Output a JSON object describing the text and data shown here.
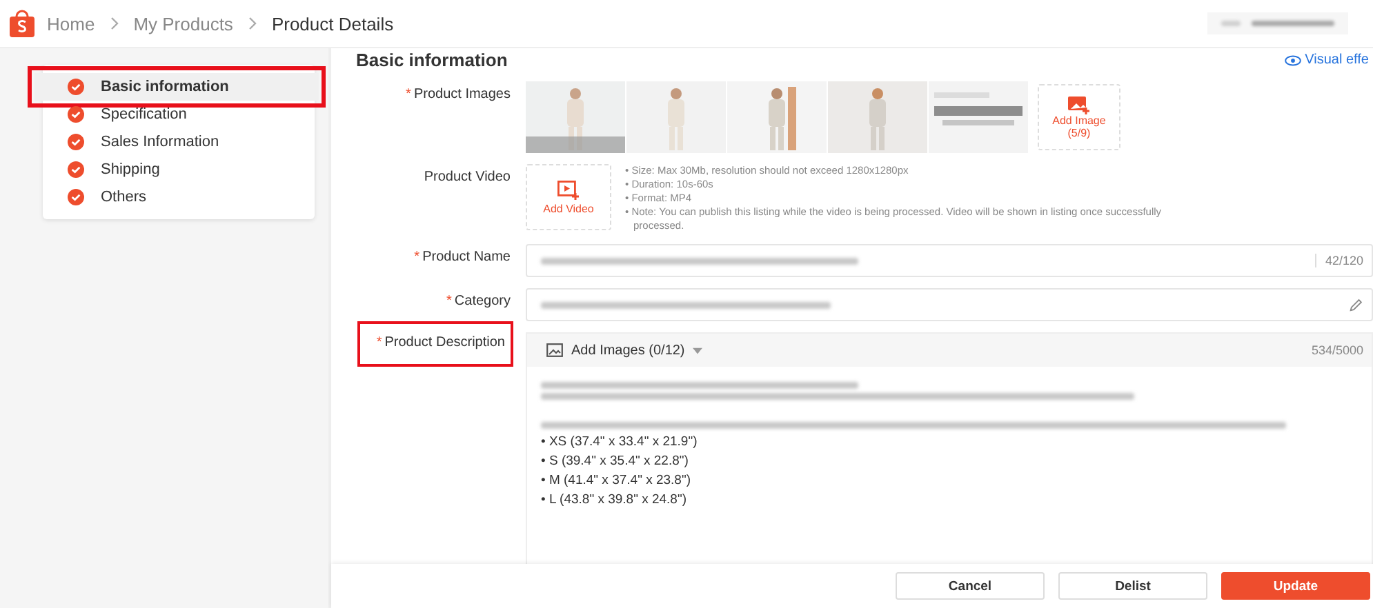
{
  "breadcrumb": [
    {
      "label": "Home",
      "current": false
    },
    {
      "label": "My Products",
      "current": false
    },
    {
      "label": "Product Details",
      "current": true
    }
  ],
  "sidebar": {
    "items": [
      {
        "label": "Basic information",
        "selected": true,
        "highlighted": true
      },
      {
        "label": "Specification",
        "selected": false,
        "highlighted": false
      },
      {
        "label": "Sales Information",
        "selected": false,
        "highlighted": false
      },
      {
        "label": "Shipping",
        "selected": false,
        "highlighted": false
      },
      {
        "label": "Others",
        "selected": false,
        "highlighted": false
      }
    ]
  },
  "section": {
    "title": "Basic information",
    "link": "Visual effe"
  },
  "required_mark": "*",
  "fields": [
    {
      "kind": "images",
      "label": "Product Images",
      "required": true,
      "highlighted": false,
      "add_label": "Add Image",
      "add_count": "(5/9)"
    },
    {
      "kind": "video",
      "label": "Product Video",
      "required": false,
      "highlighted": false,
      "add_label": "Add Video",
      "notes": [
        "• Size: Max 30Mb, resolution should not exceed 1280x1280px",
        "• Duration: 10s-60s",
        "• Format: MP4",
        "• Note: You can publish this listing while the video is being processed. Video will be shown in listing once successfully processed."
      ]
    },
    {
      "kind": "text",
      "label": "Product Name",
      "required": true,
      "highlighted": false,
      "counter": "42/120"
    },
    {
      "kind": "category",
      "label": "Category",
      "required": true,
      "highlighted": false
    },
    {
      "kind": "description",
      "label": "Product Description",
      "required": true,
      "highlighted": true,
      "toolbar": "Add Images (0/12)",
      "counter": "534/5000",
      "lines": [
        "• XS (37.4\" x 33.4\" x 21.9\")",
        "• S (39.4\" x 35.4\" x 22.8\")",
        "• M (41.4\" x 37.4\" x 23.8\")",
        "• L (43.8\" x 39.8\" x 24.8\")"
      ]
    }
  ],
  "footer": {
    "buttons": [
      {
        "label": "Cancel",
        "primary": false
      },
      {
        "label": "Delist",
        "primary": false
      },
      {
        "label": "Update",
        "primary": true
      }
    ]
  }
}
